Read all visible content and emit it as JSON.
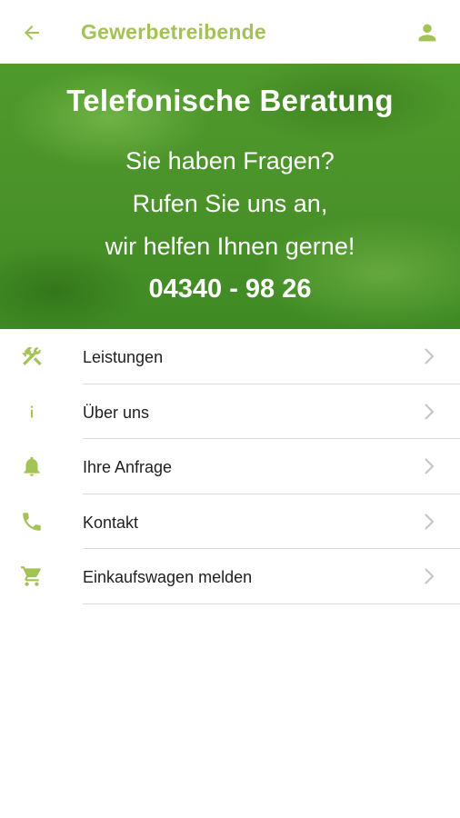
{
  "colors": {
    "accent": "#a4c355",
    "banner_green": "#4a9229",
    "text": "#1f1f1f",
    "chevron": "#c4c4c4",
    "divider": "#dadada"
  },
  "header": {
    "title": "Gewerbetreibende",
    "back_icon": "arrow-left-icon",
    "profile_icon": "person-icon"
  },
  "banner": {
    "title": "Telefonische Beratung",
    "line1": "Sie haben Fragen?",
    "line2": "Rufen Sie uns an,",
    "line3": "wir helfen Ihnen gerne!",
    "phone": "04340 - 98 26"
  },
  "menu": {
    "items": [
      {
        "label": "Leistungen",
        "icon": "tools-icon"
      },
      {
        "label": "Über uns",
        "icon": "info-icon"
      },
      {
        "label": "Ihre Anfrage",
        "icon": "bell-icon"
      },
      {
        "label": "Kontakt",
        "icon": "phone-icon"
      },
      {
        "label": "Einkaufswagen melden",
        "icon": "shopping-cart-icon"
      }
    ]
  }
}
